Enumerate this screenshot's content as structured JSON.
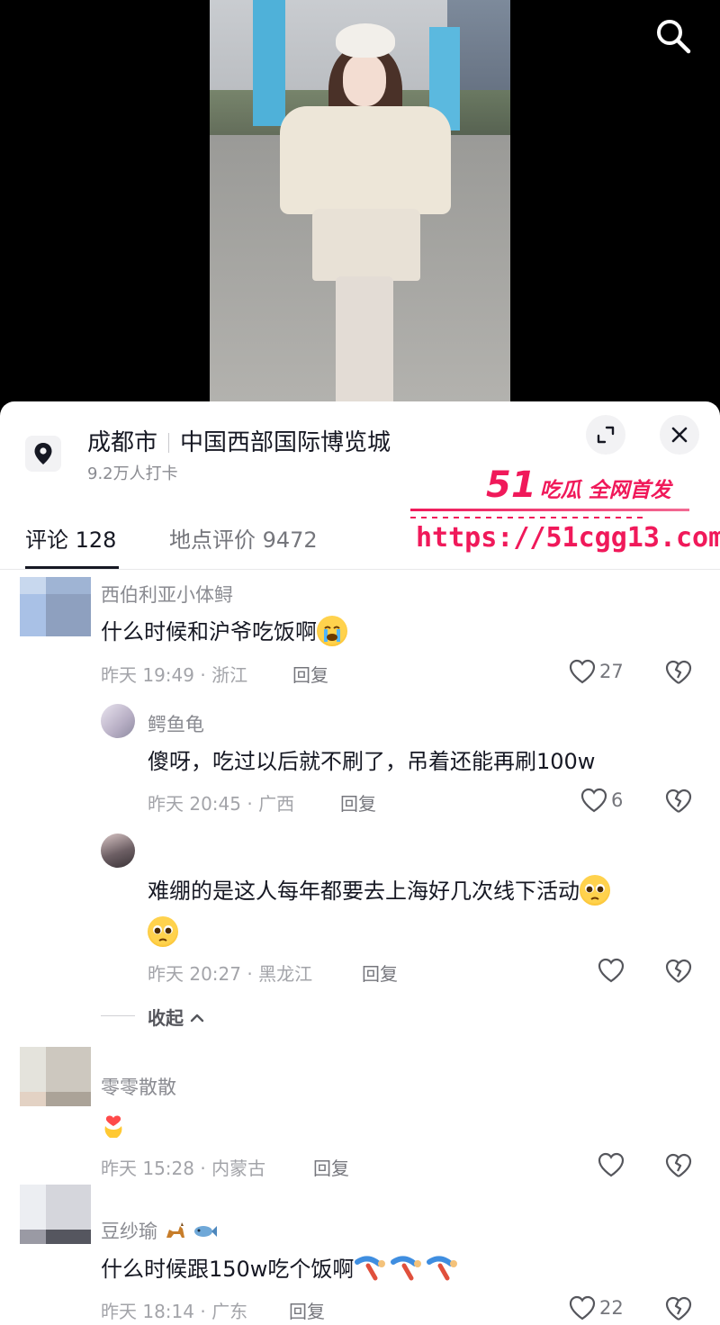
{
  "location": {
    "city": "成都市",
    "venue": "中国西部国际博览城",
    "checkins": "9.2万人打卡"
  },
  "watermark": {
    "brand_number": "51",
    "brand_text": "吃瓜 全网首发",
    "url": "https://51cgg13.com"
  },
  "tabs": [
    {
      "label": "评论 128"
    },
    {
      "label": "地点评价 9472"
    }
  ],
  "comments": [
    {
      "name": "西伯利亚小体鲟",
      "text": "什么时候和沪爷吃饭啊",
      "emoji": "loudly-crying-emoji",
      "time": "昨天 19:49 · 浙江",
      "reply": "回复",
      "likes": "27"
    },
    {
      "name": "鳄鱼龟",
      "text": "傻呀，吃过以后就不刷了，吊着还能再刷100w",
      "time": "昨天 20:45 · 广西",
      "reply": "回复",
      "likes": "6"
    },
    {
      "name": "",
      "text": "难绷的是这人每年都要去上海好几次线下活动",
      "emoji": "pleading-face-emoji",
      "time": "昨天 20:27 · 黑龙江",
      "reply": "回复",
      "likes": ""
    },
    {
      "name": "零零散散",
      "text": "",
      "emoji": "heart-hands-emoji",
      "time": "昨天 15:28 · 内蒙古",
      "reply": "回复",
      "likes": ""
    },
    {
      "name": "豆纱瑜",
      "text": "什么时候跟150w吃个饭啊",
      "emoji": "kneeling-person-emoji",
      "time": "昨天 18:14 · 广东",
      "reply": "回复",
      "likes": "22"
    }
  ],
  "collapse_label": "收起",
  "colors": {
    "accent": "#f0195a",
    "text": "#161823",
    "muted": "#8a8b91"
  }
}
